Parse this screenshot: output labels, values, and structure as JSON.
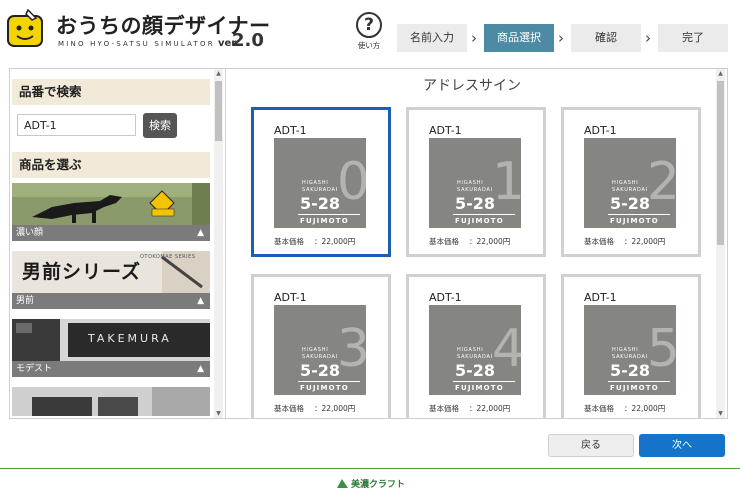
{
  "header": {
    "title": "おうちの顔デザイナー",
    "subtitle": "MINO HYO-SATSU SIMULATOR",
    "version_prefix": "ver",
    "version": "2.0",
    "help_label": "使い方",
    "help_icon": "?"
  },
  "steps": [
    {
      "label": "名前入力",
      "active": false
    },
    {
      "label": "商品選択",
      "active": true
    },
    {
      "label": "確認",
      "active": false
    },
    {
      "label": "完了",
      "active": false
    }
  ],
  "sidebar": {
    "search_heading": "品番で検索",
    "search_value": "ADT-1",
    "search_button": "検索",
    "products_heading": "商品を選ぶ",
    "categories": [
      {
        "label": "濃い顔"
      },
      {
        "label": "男前",
        "banner": "男前シリーズ",
        "banner_sub": "OTOKOMAE SERIES"
      },
      {
        "label": "モデスト",
        "plate": "TAKEMURA"
      },
      {
        "label": ""
      }
    ]
  },
  "content": {
    "title": "アドレスサイン",
    "products": [
      {
        "code": "ADT-1",
        "digit": "0",
        "price_label": "基本価格",
        "price": "：22,000円",
        "selected": true
      },
      {
        "code": "ADT-1",
        "digit": "1",
        "price_label": "基本価格",
        "price": "：22,000円",
        "selected": false
      },
      {
        "code": "ADT-1",
        "digit": "2",
        "price_label": "基本価格",
        "price": "：22,000円",
        "selected": false
      },
      {
        "code": "ADT-1",
        "digit": "3",
        "price_label": "基本価格",
        "price": "：22,000円",
        "selected": false
      },
      {
        "code": "ADT-1",
        "digit": "4",
        "price_label": "基本価格",
        "price": "：22,000円",
        "selected": false
      },
      {
        "code": "ADT-1",
        "digit": "5",
        "price_label": "基本価格",
        "price": "：22,000円",
        "selected": false
      }
    ],
    "sample": {
      "line1": "HIGASHI",
      "line2": "SAKURADAI",
      "number": "5-28",
      "name": "FUJIMOTO"
    }
  },
  "buttons": {
    "back": "戻る",
    "next": "次へ"
  },
  "footer": {
    "brand": "美濃クラフト"
  },
  "colors": {
    "active_step": "#4d8ba5",
    "selected_border": "#1c5eb0",
    "next_button": "#1574c8",
    "section_bg": "#f1ead8"
  }
}
